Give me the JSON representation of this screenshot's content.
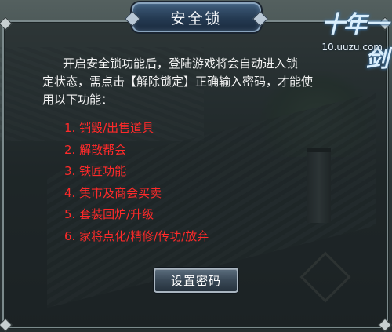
{
  "dialog": {
    "title": "安全锁",
    "intro_line1": "开启安全锁功能后，登陆游戏将会自动进入锁",
    "intro_line2": "定状态，需点击【解除锁定】正确输入密码，才能使",
    "intro_line3": "用以下功能：",
    "functions": [
      "1. 销毁/出售道具",
      "2. 解散帮会",
      "3. 铁匠功能",
      "4. 集市及商会买卖",
      "5. 套装回炉/升级",
      "6. 家将点化/精修/传功/放弃"
    ],
    "set_password_label": "设置密码"
  },
  "logo": {
    "mark": "十年一剑",
    "url": "10.uuzu.com"
  },
  "colors": {
    "function_text": "#ff2a2a",
    "body_text": "#f3f3f3",
    "title_tab": "#243a52"
  }
}
